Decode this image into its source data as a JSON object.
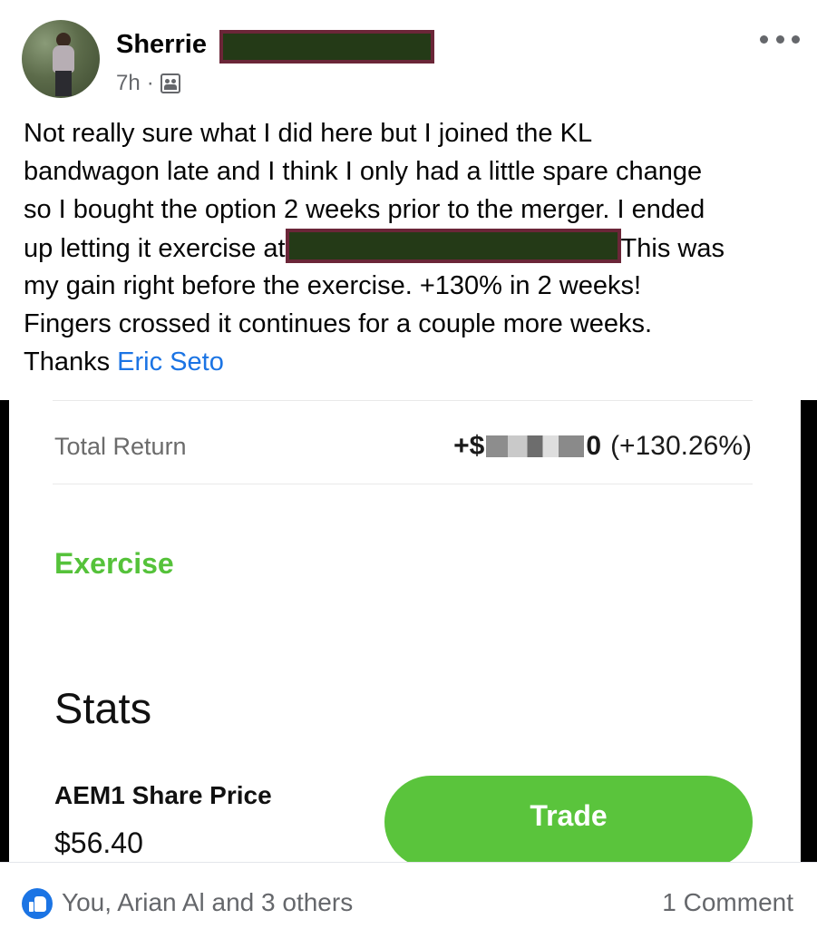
{
  "post": {
    "author_first_name": "Sherrie",
    "time_ago": "7h",
    "separator": "·",
    "audience_icon": "group-audience-icon",
    "text_lines": [
      "Not really sure what I did here but I joined the KL",
      "bandwagon late and I think I only had a little spare change",
      "so I bought the option 2 weeks prior to the merger. I ended",
      "up letting it exercise at",
      "This was",
      "my gain right before the exercise. +130% in 2 weeks!",
      "Fingers crossed it continues for a couple more weeks.",
      "Thanks"
    ],
    "mention": "Eric Seto"
  },
  "app_screenshot": {
    "total_return_label": "Total Return",
    "total_return_prefix": "+$",
    "total_return_suffix": "0",
    "total_return_percent": "(+130.26%)",
    "exercise_label": "Exercise",
    "stats_title": "Stats",
    "share_price_label": "AEM1 Share Price",
    "share_price_value": "$56.40",
    "trade_label": "Trade",
    "accent_color": "#5ac43c"
  },
  "footer": {
    "reactors": "You, Arian Al and 3 others",
    "comments": "1 Comment",
    "reaction_icon": "like-icon",
    "accent_color": "#1b74e4"
  }
}
